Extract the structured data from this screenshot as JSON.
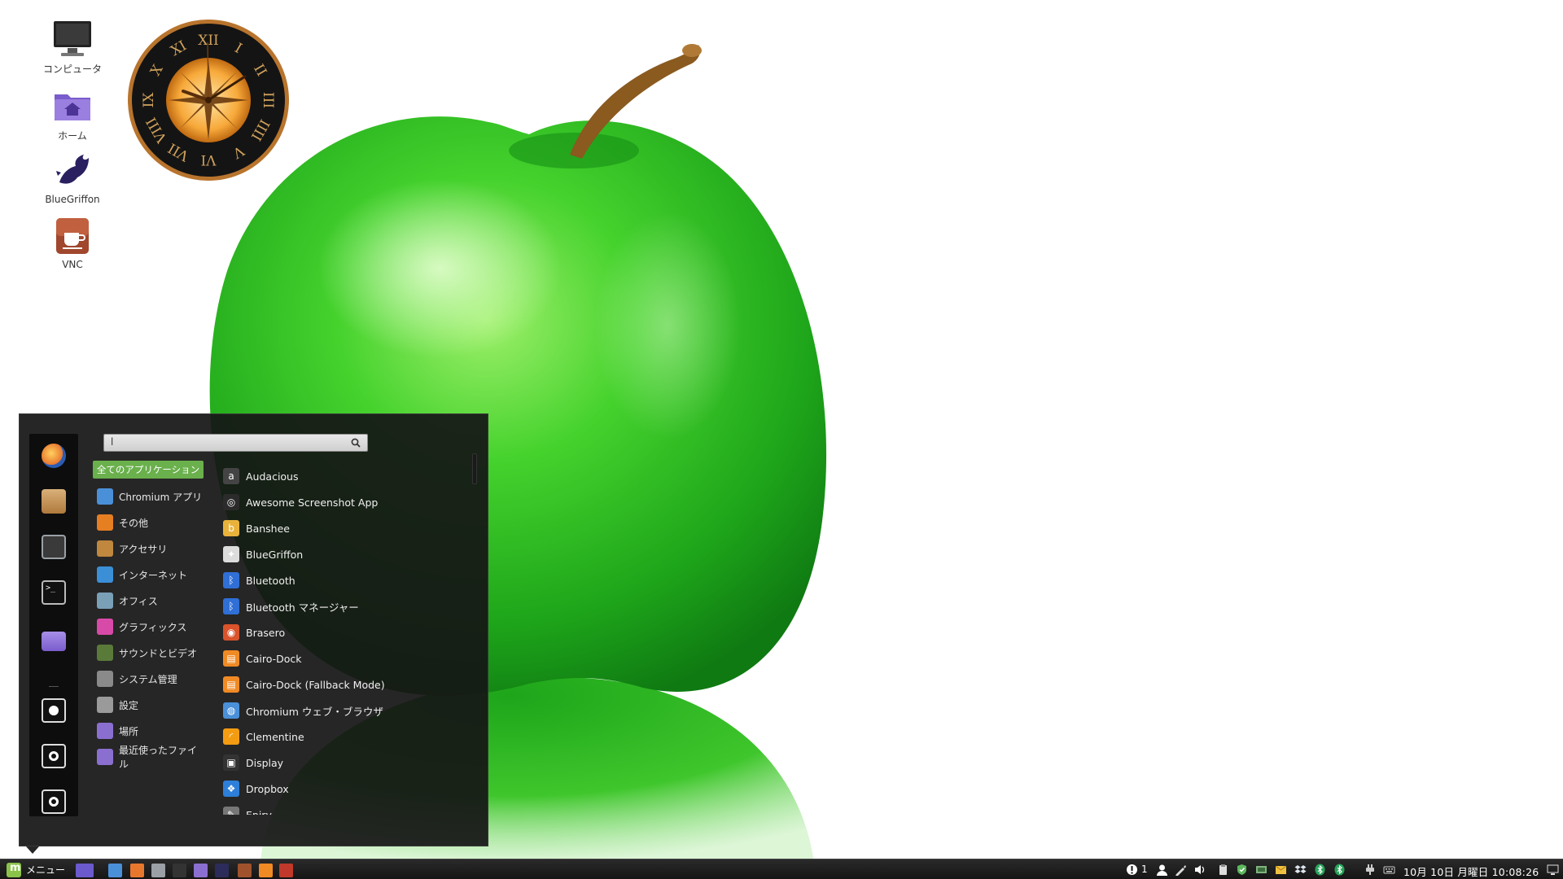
{
  "desktop_icons": [
    {
      "label": "コンピュータ",
      "icon": "computer-icon"
    },
    {
      "label": "ホーム",
      "icon": "home-folder-icon"
    },
    {
      "label": "BlueGriffon",
      "icon": "bluegriffon-icon"
    },
    {
      "label": "VNC",
      "icon": "vnc-icon"
    }
  ],
  "clock_widget": {
    "numerals": [
      "XII",
      "I",
      "II",
      "III",
      "IIII",
      "V",
      "VI",
      "VII",
      "VIII",
      "IX",
      "X",
      "XI"
    ]
  },
  "menu": {
    "search": {
      "value": "l",
      "placeholder": ""
    },
    "favorites": [
      "firefox-icon",
      "package-icon",
      "settings-icon",
      "terminal-icon",
      "folder-icon",
      "lock-icon",
      "logout-icon",
      "power-icon"
    ],
    "categories": [
      {
        "label": "全てのアプリケーション",
        "color": "#6ab04c"
      },
      {
        "label": "Chromium アプリ",
        "color": "#4a90d9"
      },
      {
        "label": "その他",
        "color": "#e67e22"
      },
      {
        "label": "アクセサリ",
        "color": "#c0873f"
      },
      {
        "label": "インターネット",
        "color": "#3b8fd6"
      },
      {
        "label": "オフィス",
        "color": "#7aa0b8"
      },
      {
        "label": "グラフィックス",
        "color": "#d84aa8"
      },
      {
        "label": "サウンドとビデオ",
        "color": "#5a7a3a"
      },
      {
        "label": "システム管理",
        "color": "#8a8a8a"
      },
      {
        "label": "設定",
        "color": "#9a9a9a"
      },
      {
        "label": "場所",
        "color": "#8b6fd0"
      },
      {
        "label": "最近使ったファイル",
        "color": "#8b6fd0"
      }
    ],
    "applications": [
      {
        "label": "Audacious",
        "color": "#444444",
        "glyph": "a"
      },
      {
        "label": "Awesome Screenshot App",
        "color": "#2b2b2b",
        "glyph": "◎"
      },
      {
        "label": "Banshee",
        "color": "#e9b33b",
        "glyph": "b"
      },
      {
        "label": "BlueGriffon",
        "color": "#dcdcdc",
        "glyph": "✦"
      },
      {
        "label": "Bluetooth",
        "color": "#2f6fd6",
        "glyph": "ᛒ"
      },
      {
        "label": "Bluetooth マネージャー",
        "color": "#2f6fd6",
        "glyph": "ᛒ"
      },
      {
        "label": "Brasero",
        "color": "#d9532b",
        "glyph": "◉"
      },
      {
        "label": "Cairo-Dock",
        "color": "#f08a24",
        "glyph": "▤"
      },
      {
        "label": "Cairo-Dock (Fallback Mode)",
        "color": "#f08a24",
        "glyph": "▤"
      },
      {
        "label": "Chromium ウェブ・ブラウザ",
        "color": "#4a90d9",
        "glyph": "◍"
      },
      {
        "label": "Clementine",
        "color": "#f39c12",
        "glyph": "◜"
      },
      {
        "label": "Display",
        "color": "#333333",
        "glyph": "▣"
      },
      {
        "label": "Dropbox",
        "color": "#2d7fd9",
        "glyph": "❖"
      },
      {
        "label": "Epiry",
        "color": "#777777",
        "glyph": "✎"
      }
    ]
  },
  "panel": {
    "menu_label": "メニュー",
    "launchers": [
      {
        "icon": "show-desktop-icon",
        "color": "#6a5acd"
      },
      {
        "icon": "chromium-icon",
        "color": "#4a90d9"
      },
      {
        "icon": "firefox-icon",
        "color": "#e8772e"
      },
      {
        "icon": "settings-icon",
        "color": "#9aa0a6"
      },
      {
        "icon": "terminal-icon",
        "color": "#333333"
      },
      {
        "icon": "folder-icon",
        "color": "#8b6fd0"
      },
      {
        "icon": "bluegriffon-icon",
        "color": "#2c2c5a"
      },
      {
        "icon": "vnc-icon",
        "color": "#a0522d"
      },
      {
        "icon": "rss-icon",
        "color": "#f08a24"
      },
      {
        "icon": "app-grid-icon",
        "color": "#c0392b"
      }
    ],
    "notification_count": "1",
    "clock": "10月 10日 月曜日 10:08:26"
  }
}
